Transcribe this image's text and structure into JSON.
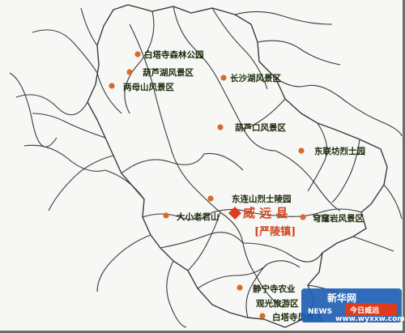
{
  "map": {
    "county_label": "威 远 县",
    "town_label": "[严陵镇]",
    "pois": [
      {
        "name": "白塔寺森林公园"
      },
      {
        "name": "葫芦湖风景区"
      },
      {
        "name": "长沙湖风景区"
      },
      {
        "name": "两母山风景区"
      },
      {
        "name": "葫芦口风景区"
      },
      {
        "name": "东联坊烈士园"
      },
      {
        "name": "东连山烈士陵园"
      },
      {
        "name": "大小老君山"
      },
      {
        "name": "穹窿岩风景区"
      },
      {
        "name": "静宁寺农业"
      },
      {
        "name": "观光旅游区"
      },
      {
        "name": "白塔寺风景区"
      }
    ]
  },
  "logo": {
    "brand_cn": "新华网",
    "brand_news": "NEWS",
    "slogan": "今日威远",
    "url": "www.wyxxw.com",
    "colors": {
      "accent": "#e03a1e",
      "road": "#3b3b3b",
      "dot": "#d86a2c",
      "label": "#1a2a08",
      "logo_blue": "#1e5fb4"
    }
  }
}
